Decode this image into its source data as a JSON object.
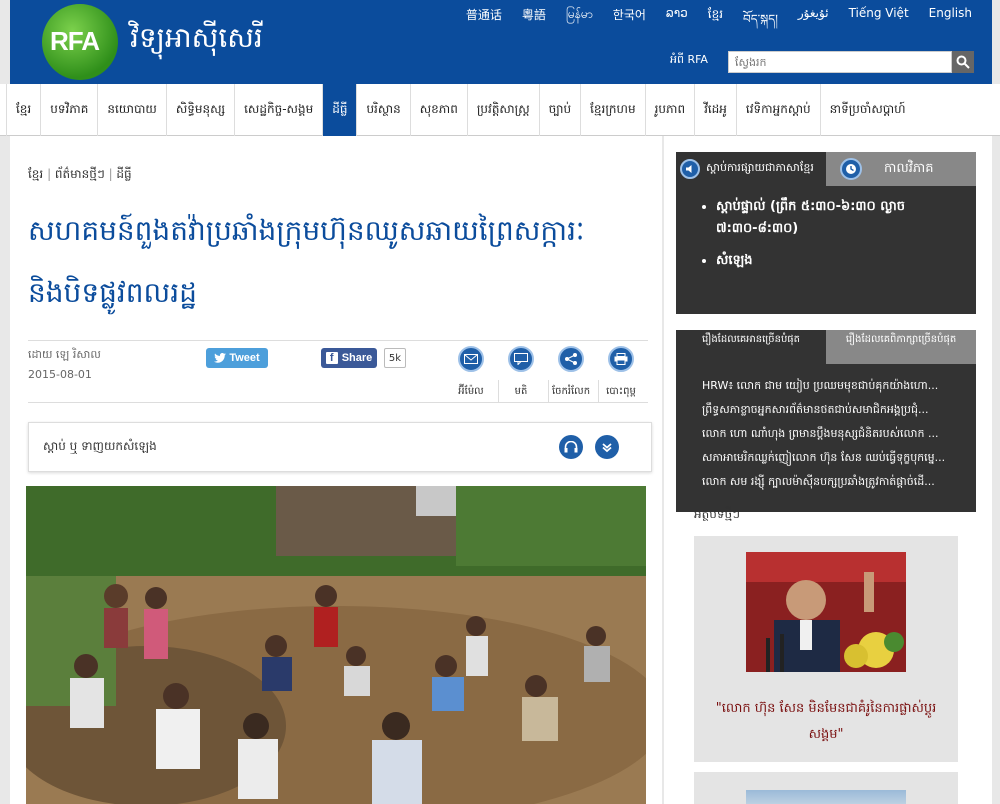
{
  "header": {
    "logo": "RFA",
    "site_name": "វិទ្យុអាស៊ីសេរី",
    "languages": [
      "普通话",
      "粵語",
      "မြန်မာ",
      "한국어",
      "ລາວ",
      "ខ្មែរ",
      "བོད་སྐད།",
      "ئۇيغۇر",
      "Tiếng Việt",
      "English"
    ],
    "about": "អំពី RFA",
    "search_placeholder": "ស្វែងរក"
  },
  "nav": {
    "items": [
      "ខ្មែរ",
      "បទវិភាគ",
      "នយោបាយ",
      "សិទ្ធិមនុស្ស",
      "សេដ្ឋកិច្ច-សង្គម",
      "ដីធ្លី",
      "បរិស្ថាន",
      "សុខភាព",
      "ប្រវត្តិសាស្ត្រ",
      "ច្បាប់",
      "ខ្មែរក្រហម",
      "រូបភាព",
      "វីដេអូ",
      "វេទិកាអ្នកស្ដាប់",
      "នាទីប្រចាំសប្ដាហ៍"
    ],
    "active": "ដីធ្លី"
  },
  "article": {
    "breadcrumb": [
      "ខ្មែរ",
      "ព័ត៌មានថ្មីៗ",
      "ដីធ្លី"
    ],
    "headline": "សហគមន៍ពួងតវ៉ាប្រឆាំងក្រុមហ៊ុនឈូសឆាយព្រៃសក្ការៈនិងបិទផ្លូវពលរដ្ឋ",
    "byline": "ដោយ ឡេ រិសាល",
    "date": "2015-08-01",
    "tweet_label": "Tweet",
    "share_label": "Share",
    "share_count": "5k",
    "tools": [
      "អ៊ីម៉ែល",
      "មតិ",
      "ចែករំលែក",
      "បោះពុម្ព"
    ],
    "audio_label": "ស្ដាប់ ឬ ទាញយកសំឡេង"
  },
  "sidebar": {
    "live_tab": "ស្ដាប់ការផ្សាយជាភាសាខ្មែរ",
    "schedule_tab": "កាលវិភាគ",
    "live_items": [
      "ស្ដាប់ផ្ទាល់ (ព្រឹក ៥:៣០-៦:៣០ ល្ងាច ៧:៣០-៨:៣០)",
      "សំឡេង"
    ],
    "popular_tab": "រឿងដែលគេអានច្រើនបំផុត",
    "popular_tab_b": "រឿងដែលគេពិភាក្សាច្រើនបំផុត",
    "popular_items": [
      "HRW៖ លោក ជាម យៀប ប្រឈមមុខជាប់គុកយ៉ាងហោ...",
      "ព្រឹទ្ធសភាខ្លាចអ្នកសារព័ត៌មានថតជាប់សមាជិកអង្គប្រជុំ...",
      "លោក ហោ ណាំហុង ព្រមានប្ដឹងមនុស្សជំនិតរបស់លោក ...",
      "សភាអាមេរិកឈ្លក់ញៀលោក ហ៊ុន សែន ឈប់ធ្វើទុក្ខបុកម្នេ...",
      "លោក សម រង្ស៊ី ក្បាលម៉ាស៊ីនបក្សប្រឆាំងត្រូវកាត់ផ្ដាច់ដើ..."
    ],
    "recent_title": "អត្ថបទថ្មីៗ",
    "feature_caption": "\"លោក ហ៊ុន សែន មិនមែនជាគំរូនៃការផ្លាស់ប្ដូរសង្គម\""
  },
  "colors": {
    "brand": "#0b4c9c",
    "logo_green": "#3a9a22",
    "dark_panel": "#333333",
    "caption": "#7a1010"
  }
}
